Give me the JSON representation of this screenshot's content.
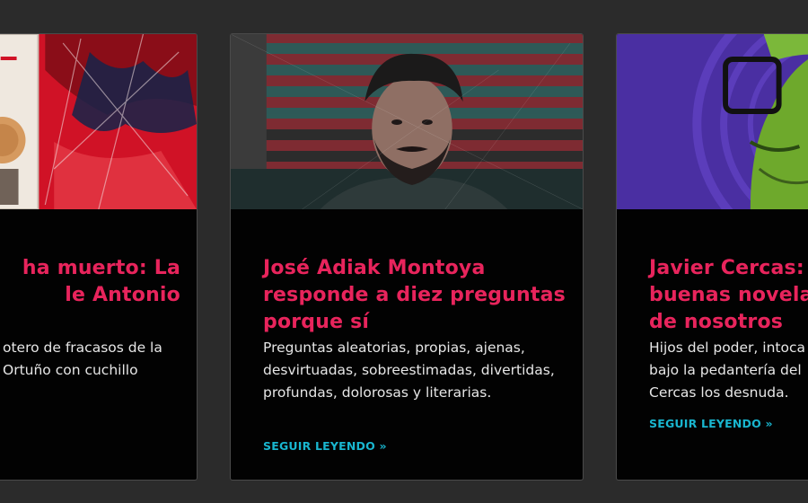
{
  "cards": [
    {
      "title_lines": [
        "ha muerto: La",
        "le Antonio"
      ],
      "excerpt_lines": [
        "otero de fracasos de la",
        "Ortuño con cuchillo",
        ""
      ],
      "image_alt": "book-collage-illustration"
    },
    {
      "title": "José Adiak Montoya responde a diez preguntas porque sí",
      "excerpt": "Preguntas aleatorias, propias, ajenas, desvirtuadas, sobreestimadas, divertidas, profundas, dolorosas y literarias.",
      "read_more": "SEGUIR LEYENDO »",
      "image_alt": "portrait-jose-adiak-montoya"
    },
    {
      "title_lines": [
        "Javier Cercas:",
        "buenas novela",
        "de nosotros"
      ],
      "excerpt_lines": [
        "Hijos del poder, intoca",
        "bajo la pedantería del",
        "Cercas los desnuda."
      ],
      "read_more": "SEGUIR LEYENDO »",
      "image_alt": "portrait-javier-cercas"
    }
  ],
  "colors": {
    "page_bg": "#2b2b2b",
    "card_bg": "#020202",
    "title": "#e8245c",
    "link": "#19b6cf",
    "text": "#e6e6e6"
  }
}
